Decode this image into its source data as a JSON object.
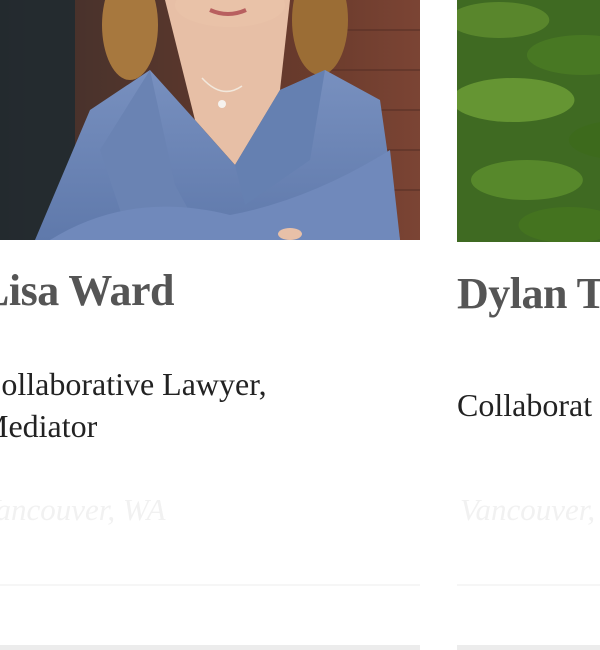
{
  "profiles": [
    {
      "name": "Lisa Ward",
      "role_line1": "Collaborative Lawyer,",
      "role_line2": "Mediator",
      "location": "Vancouver, WA",
      "photo_icon": "portrait-photo"
    },
    {
      "name": "Dylan T",
      "role_line1": "Collaborat",
      "role_line2": "",
      "location": "Vancouver,",
      "photo_icon": "portrait-photo"
    }
  ],
  "colors": {
    "name_text": "#555555",
    "role_text": "#222222",
    "location_text": "#f1f1f1",
    "jacket_blue": "#6b85b5",
    "foliage_green": "#4f7a2a",
    "brick": "#6e3a2c"
  }
}
